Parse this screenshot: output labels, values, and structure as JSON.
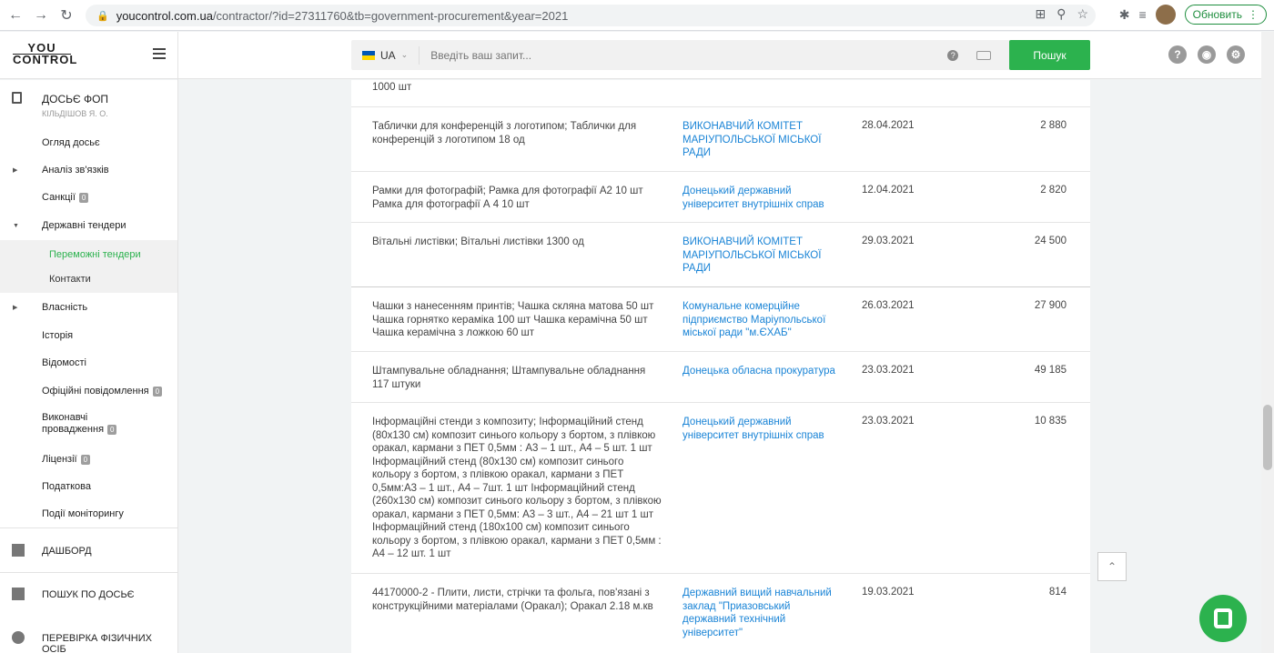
{
  "browser": {
    "url_host": "youcontrol.com.ua",
    "url_path": "/contractor/?id=27311760&tb=government-procurement&year=2021",
    "update_label": "Обновить"
  },
  "header": {
    "logo_line1": "YOU",
    "logo_line2": "CONTROL",
    "lang": "UA",
    "search_placeholder": "Введіть ваш запит...",
    "search_button": "Пошук"
  },
  "sidebar": {
    "dossier_title": "ДОСЬЄ ФОП",
    "dossier_sub": "КІЛЬДІШОВ Я. О.",
    "items": [
      {
        "label": "Огляд досьє"
      },
      {
        "label": "Аналіз зв'язків"
      },
      {
        "label": "Санкції",
        "badge": "0"
      },
      {
        "label": "Державні тендери"
      },
      {
        "label": "Переможні тендери"
      },
      {
        "label": "Контакти"
      },
      {
        "label": "Власність"
      },
      {
        "label": "Історія"
      },
      {
        "label": "Відомості"
      },
      {
        "label": "Офіційні повідомлення",
        "badge": "0"
      },
      {
        "label": "Виконавчі",
        "label2": "провадження",
        "badge": "0"
      },
      {
        "label": "Ліцензії",
        "badge": "0"
      },
      {
        "label": "Податкова"
      },
      {
        "label": "Події моніторингу"
      }
    ],
    "dashboard": "ДАШБОРД",
    "search_dossier": "ПОШУК ПО ДОСЬЄ",
    "person_check": "ПЕРЕВІРКА ФІЗИЧНИХ ОСІБ"
  },
  "table": {
    "top_fragment": "1000 шт",
    "rows": [
      {
        "desc": "Таблички для конференцій з логотипом; Таблички для конференцій з логотипом 18 од",
        "customer": "ВИКОНАВЧИЙ КОМІТЕТ МАРІУПОЛЬСЬКОЇ МІСЬКОЇ РАДИ",
        "date": "28.04.2021",
        "amount": "2 880"
      },
      {
        "desc": "Рамки для фотографій; Рамка для фотографії А2 10 шт Рамка для фотографії А 4 10 шт",
        "customer": "Донецький державний університет внутрішніх справ",
        "date": "12.04.2021",
        "amount": "2 820"
      },
      {
        "desc": "Вітальні листівки; Вітальні листівки 1300 од",
        "customer": "ВИКОНАВЧИЙ КОМІТЕТ МАРІУПОЛЬСЬКОЇ МІСЬКОЇ РАДИ",
        "date": "29.03.2021",
        "amount": "24 500"
      },
      {
        "desc": "Чашки з нанесенням принтів; Чашка скляна матова 50 шт Чашка горнятко кераміка 100 шт Чашка керамічна 50 шт Чашка керамічна з ложкою 60 шт",
        "customer": "Комунальне комерційне підприємство Маріупольської міської ради \"м.ЄХАБ\"",
        "date": "26.03.2021",
        "amount": "27 900"
      },
      {
        "desc": "Штампувальне обладнання; Штампувальне обладнання 117 штуки",
        "customer": "Донецька обласна прокуратура",
        "date": "23.03.2021",
        "amount": "49 185"
      },
      {
        "desc": "Інформаційні стенди з композиту; Інформаційний стенд (80х130 см) композит синього кольору з бортом, з плівкою оракал, кармани з ПЕТ 0,5мм : А3 – 1 шт., А4 – 5 шт. 1 шт Інформаційний стенд (80х130 см) композит синього кольору з бортом, з плівкою оракал, кармани з ПЕТ 0,5мм:А3 – 1 шт., А4 – 7шт. 1 шт Інформаційний стенд (260х130 см) композит синього кольору з бортом, з плівкою оракал, кармани з ПЕТ 0,5мм: А3 – 3 шт., А4 – 21 шт 1 шт Інформаційний стенд (180х100 см) композит синього кольору з бортом, з плівкою оракал, кармани з ПЕТ 0,5мм : А4 – 12 шт. 1 шт",
        "customer": "Донецький державний університет внутрішніх справ",
        "date": "23.03.2021",
        "amount": "10 835"
      },
      {
        "desc": "44170000-2 - Плити, листи, стрічки та фольга, пов'язані з конструкційними матеріалами (Оракал); Оракал 2.18 м.кв",
        "customer": "Державний вищий навчальний заклад \"Приазовський державний технічний університет\"",
        "date": "19.03.2021",
        "amount": "814"
      }
    ]
  },
  "colors": {
    "accent": "#2cb24e",
    "link": "#1a84d6"
  }
}
